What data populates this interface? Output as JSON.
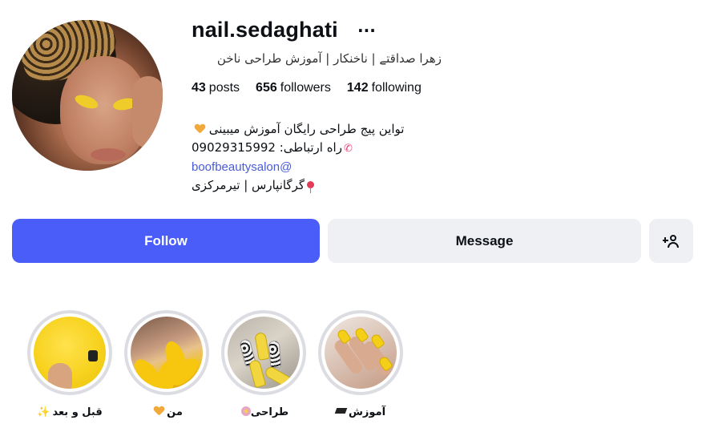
{
  "profile": {
    "username": "nail.sedaghati",
    "full_name": "زهرا صداقتے | ناخنکار | آموزش طراحی ناخن",
    "stats": {
      "posts_count": "43",
      "posts_label": "posts",
      "followers_count": "656",
      "followers_label": "followers",
      "following_count": "142",
      "following_label": "following"
    },
    "bio": {
      "line1": "تواین پیج طراحی رایگان آموزش میبینی",
      "line2": "راه ارتباطی: 09029315992",
      "mention": "boofbeautysalon@",
      "line4": "گرگانپارس | تیرمرکزی"
    },
    "icons": {
      "line1": "orange-heart",
      "line2": "telephone-receiver",
      "line4": "round-pushpin",
      "more": "ellipsis"
    }
  },
  "actions": {
    "follow_label": "Follow",
    "message_label": "Message",
    "add_user_icon": "add-person"
  },
  "highlights": [
    {
      "label": "قبل و بعد",
      "emoji": "sparkles"
    },
    {
      "label": "من",
      "emoji": "orange-heart"
    },
    {
      "label": "طراحی",
      "emoji": "blossom"
    },
    {
      "label": "آموزش",
      "emoji": "graduation-cap"
    }
  ],
  "colors": {
    "follow_button": "#4a5df9",
    "secondary_button": "#eff0f4",
    "link": "#4a5bd6",
    "highlight_ring": "#dcdde2"
  }
}
